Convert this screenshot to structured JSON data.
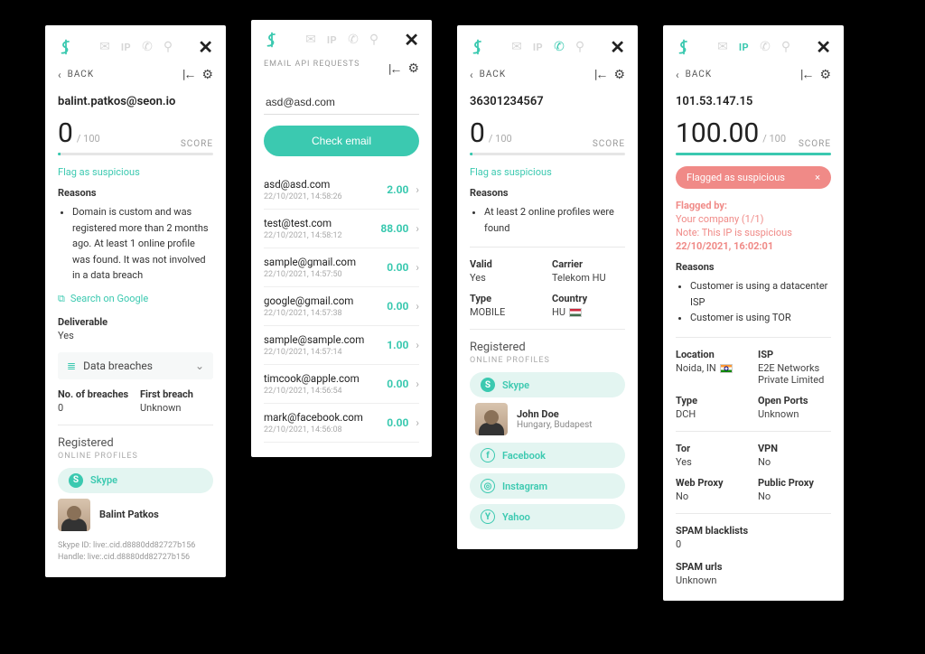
{
  "common": {
    "back": "BACK",
    "score_label": "SCORE",
    "score_max": "/ 100",
    "flag_link": "Flag as suspicious",
    "reasons_title": "Reasons",
    "registered_title": "Registered",
    "registered_sub": "ONLINE PROFILES"
  },
  "p1": {
    "subject": "balint.patkos@seon.io",
    "score": "0",
    "reason": "Domain is custom and was registered more than 2 months ago. At least 1 online profile was found. It was not involved in a data breach",
    "google": "Search on Google",
    "deliverable_label": "Deliverable",
    "deliverable_value": "Yes",
    "breaches_title": "Data breaches",
    "no_breaches_label": "No. of breaches",
    "no_breaches_value": "0",
    "first_breach_label": "First breach",
    "first_breach_value": "Unknown",
    "profile_skype": "Skype",
    "person_name": "Balint Patkos",
    "skype_id": "Skype ID: live:.cid.d8880dd82727b156",
    "handle": "Handle: live:.cid.d8880dd82727b156"
  },
  "p2": {
    "title": "EMAIL API REQUESTS",
    "input_value": "asd@asd.com",
    "button": "Check email",
    "items": [
      {
        "email": "asd@asd.com",
        "ts": "22/10/2021, 14:58:26",
        "score": "2.00"
      },
      {
        "email": "test@test.com",
        "ts": "22/10/2021, 14:58:12",
        "score": "88.00"
      },
      {
        "email": "sample@gmail.com",
        "ts": "22/10/2021, 14:57:50",
        "score": "0.00"
      },
      {
        "email": "google@gmail.com",
        "ts": "22/10/2021, 14:57:38",
        "score": "0.00"
      },
      {
        "email": "sample@sample.com",
        "ts": "22/10/2021, 14:57:14",
        "score": "1.00"
      },
      {
        "email": "timcook@apple.com",
        "ts": "22/10/2021, 14:56:54",
        "score": "0.00"
      },
      {
        "email": "mark@facebook.com",
        "ts": "22/10/2021, 14:56:08",
        "score": "0.00"
      }
    ]
  },
  "p3": {
    "subject": "36301234567",
    "score": "0",
    "reason": "At least 2 online profiles were found",
    "valid_label": "Valid",
    "valid_value": "Yes",
    "carrier_label": "Carrier",
    "carrier_value": "Telekom HU",
    "type_label": "Type",
    "type_value": "MOBILE",
    "country_label": "Country",
    "country_value": "HU",
    "profiles": {
      "skype": "Skype",
      "facebook": "Facebook",
      "instagram": "Instagram",
      "yahoo": "Yahoo"
    },
    "person_name": "John Doe",
    "person_loc": "Hungary, Budapest"
  },
  "p4": {
    "subject": "101.53.147.15",
    "score": "100.00",
    "banner": "Flagged as suspicious",
    "flagged_by_title": "Flagged by:",
    "flagged_by_value": "Your company (1/1)",
    "flagged_note": "Note: This IP is suspicious",
    "flagged_ts": "22/10/2021, 16:02:01",
    "reasons": [
      "Customer is using a datacenter ISP",
      "Customer is using TOR"
    ],
    "location_label": "Location",
    "location_value": "Noida, IN",
    "isp_label": "ISP",
    "isp_value": "E2E Networks Private Limited",
    "type_label": "Type",
    "type_value": "DCH",
    "ports_label": "Open Ports",
    "ports_value": "Unknown",
    "tor_label": "Tor",
    "tor_value": "Yes",
    "vpn_label": "VPN",
    "vpn_value": "No",
    "webproxy_label": "Web Proxy",
    "webproxy_value": "No",
    "pubproxy_label": "Public Proxy",
    "pubproxy_value": "No",
    "spam_bl_label": "SPAM blacklists",
    "spam_bl_value": "0",
    "spam_url_label": "SPAM urls",
    "spam_url_value": "Unknown"
  }
}
